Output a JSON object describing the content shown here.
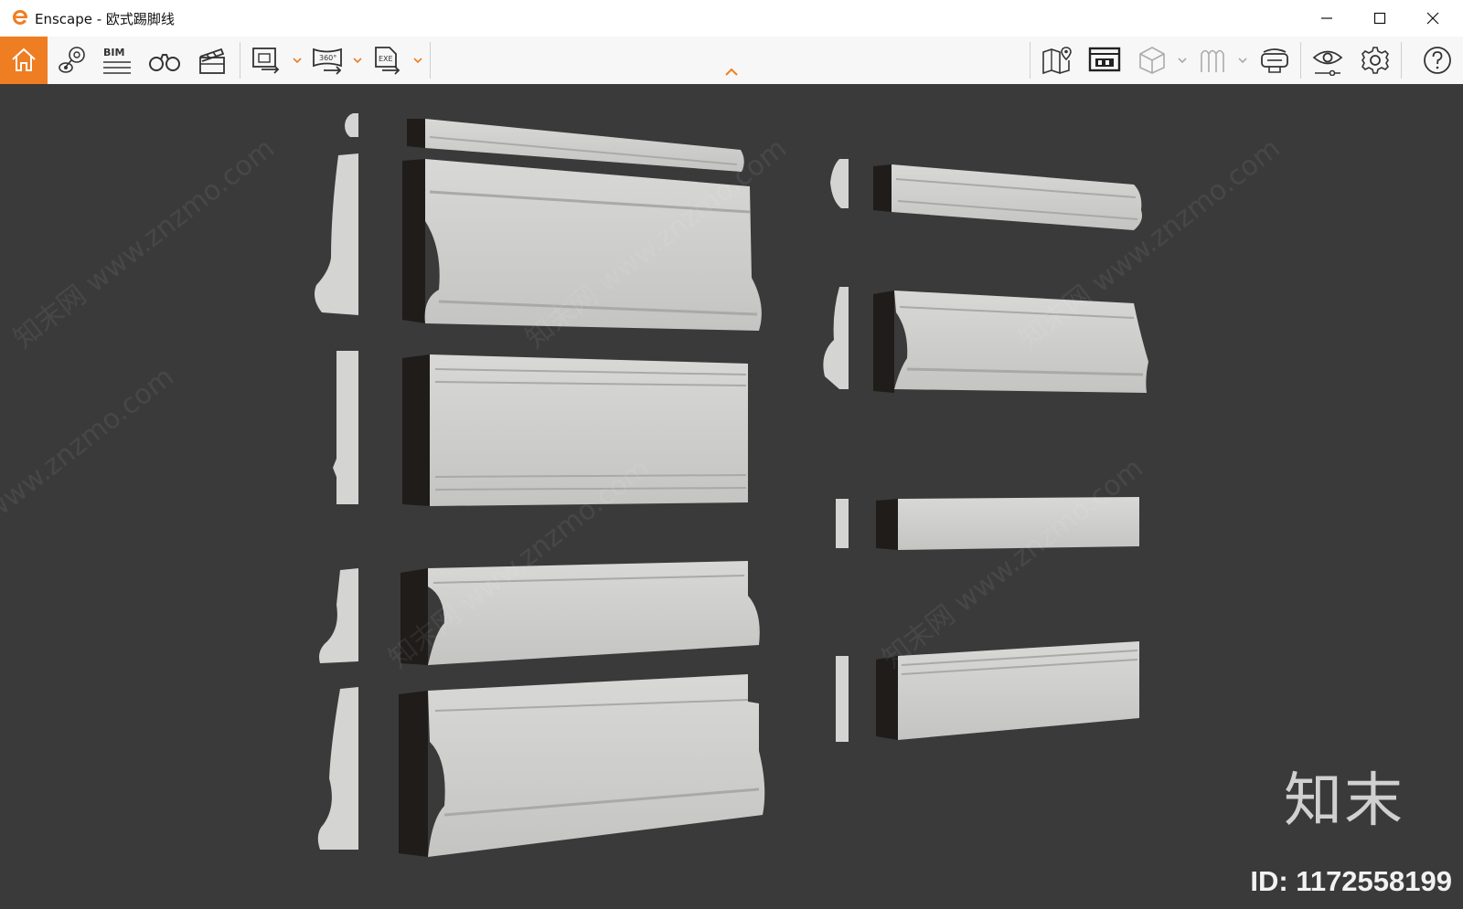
{
  "window": {
    "title": "Enscape - 欧式踢脚线",
    "minimize_label": "minimize",
    "maximize_label": "maximize",
    "close_label": "close"
  },
  "toolbar": {
    "bim_label": "BIM",
    "pano_label": "360°",
    "exe_label": "EXE",
    "accent": "#ef7d22"
  },
  "viewport": {
    "background": "#3a3a3a",
    "watermark_text": "知末网 www.znzmo.com",
    "brand": "知末",
    "id_text": "ID: 1172558199"
  }
}
